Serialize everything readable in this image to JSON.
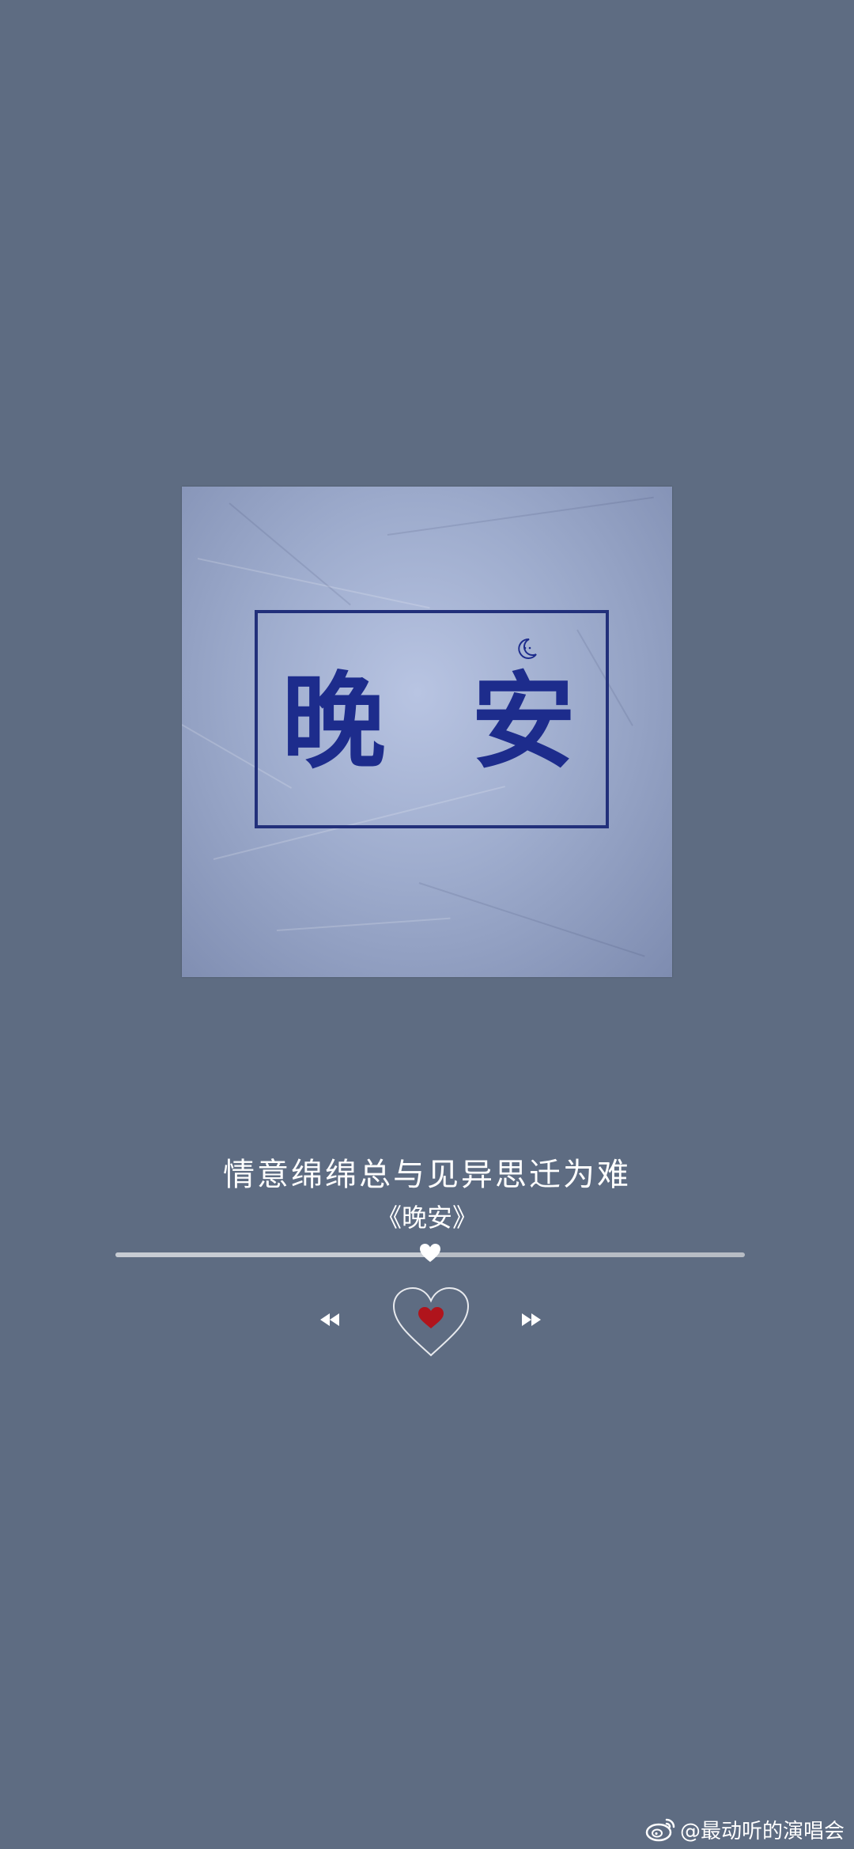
{
  "album_art": {
    "word1": "晚",
    "word2": "安"
  },
  "lyric": "情意绵绵总与见异思迁为难",
  "song_title": "《晚安》",
  "playback": {
    "progress": 0.5
  },
  "controls": {
    "prev_icon": "rewind-icon",
    "next_icon": "fast-forward-icon",
    "center_icon": "heart-icon"
  },
  "colors": {
    "background": "#5e6c82",
    "heart_red": "#b0141c",
    "ink_blue": "#1d2c8c"
  },
  "watermark": {
    "text": "@最动听的演唱会",
    "icon": "weibo-icon"
  }
}
